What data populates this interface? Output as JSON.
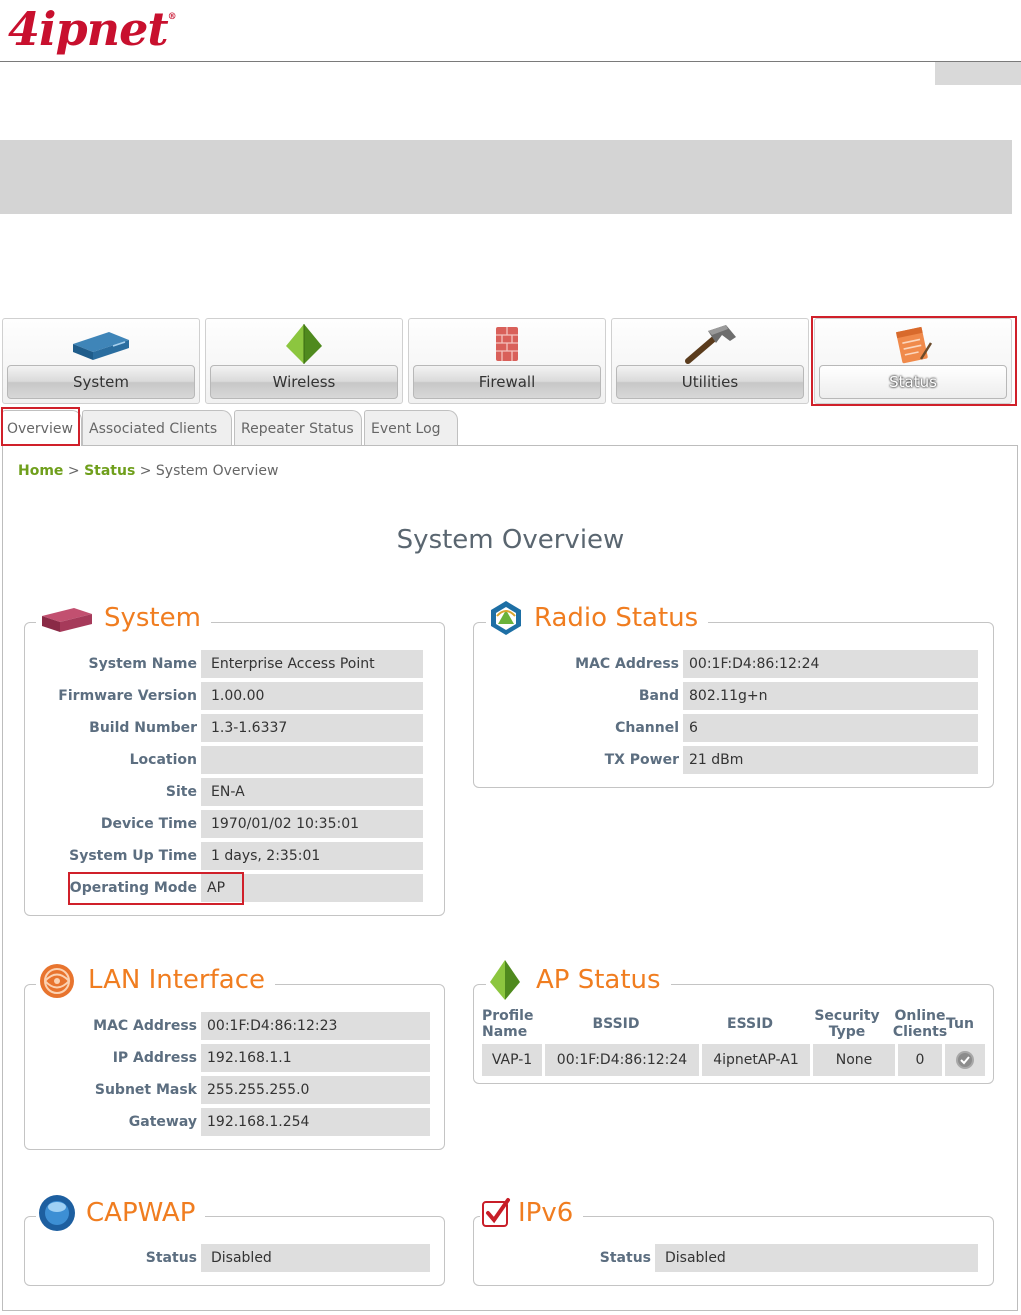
{
  "doc": {
    "logo": "4ipnet",
    "logo_mark": "®"
  },
  "nav": {
    "tabs": [
      {
        "label": "System",
        "icon": "router-icon"
      },
      {
        "label": "Wireless",
        "icon": "wireless-pyramid-icon"
      },
      {
        "label": "Firewall",
        "icon": "firewall-brick-icon"
      },
      {
        "label": "Utilities",
        "icon": "hammer-icon"
      },
      {
        "label": "Status",
        "icon": "notepad-icon",
        "active": true
      }
    ]
  },
  "subtabs": [
    "Overview",
    "Associated Clients",
    "Repeater Status",
    "Event Log"
  ],
  "breadcrumb": {
    "home": "Home",
    "sep1": ">",
    "status": "Status",
    "sep2": ">",
    "current": "System Overview"
  },
  "page_title": "System Overview",
  "system": {
    "title": "System",
    "rows": [
      {
        "label": "System Name",
        "value": "Enterprise Access Point"
      },
      {
        "label": "Firmware Version",
        "value": "1.00.00"
      },
      {
        "label": "Build Number",
        "value": "1.3-1.6337"
      },
      {
        "label": "Location",
        "value": ""
      },
      {
        "label": "Site",
        "value": "EN-A"
      },
      {
        "label": "Device Time",
        "value": "1970/01/02 10:35:01"
      },
      {
        "label": "System Up Time",
        "value": "1 days, 2:35:01"
      },
      {
        "label": "Operating Mode",
        "value": "AP"
      }
    ]
  },
  "radio": {
    "title": "Radio Status",
    "rows": [
      {
        "label": "MAC Address",
        "value": "00:1F:D4:86:12:24"
      },
      {
        "label": "Band",
        "value": "802.11g+n"
      },
      {
        "label": "Channel",
        "value": "6"
      },
      {
        "label": "TX Power",
        "value": "21 dBm"
      }
    ]
  },
  "lan": {
    "title": "LAN Interface",
    "rows": [
      {
        "label": "MAC Address",
        "value": "00:1F:D4:86:12:23"
      },
      {
        "label": "IP Address",
        "value": "192.168.1.1"
      },
      {
        "label": "Subnet Mask",
        "value": "255.255.255.0"
      },
      {
        "label": "Gateway",
        "value": "192.168.1.254"
      }
    ]
  },
  "ap": {
    "title": "AP Status",
    "headers": [
      "Profile Name",
      "BSSID",
      "ESSID",
      "Security Type",
      "Online Clients",
      "Tun"
    ],
    "row": [
      "VAP-1",
      "00:1F:D4:86:12:24",
      "4ipnetAP-A1",
      "None",
      "0"
    ]
  },
  "capwap": {
    "title": "CAPWAP",
    "label": "Status",
    "value": "Disabled"
  },
  "ipv6": {
    "title": "IPv6",
    "label": "Status",
    "value": "Disabled"
  },
  "colors": {
    "accent_orange": "#f07d20",
    "link_green": "#6f9f1c",
    "label_blue": "#5c6e80",
    "highlight_red": "#d0202a",
    "value_bg": "#dedede"
  }
}
